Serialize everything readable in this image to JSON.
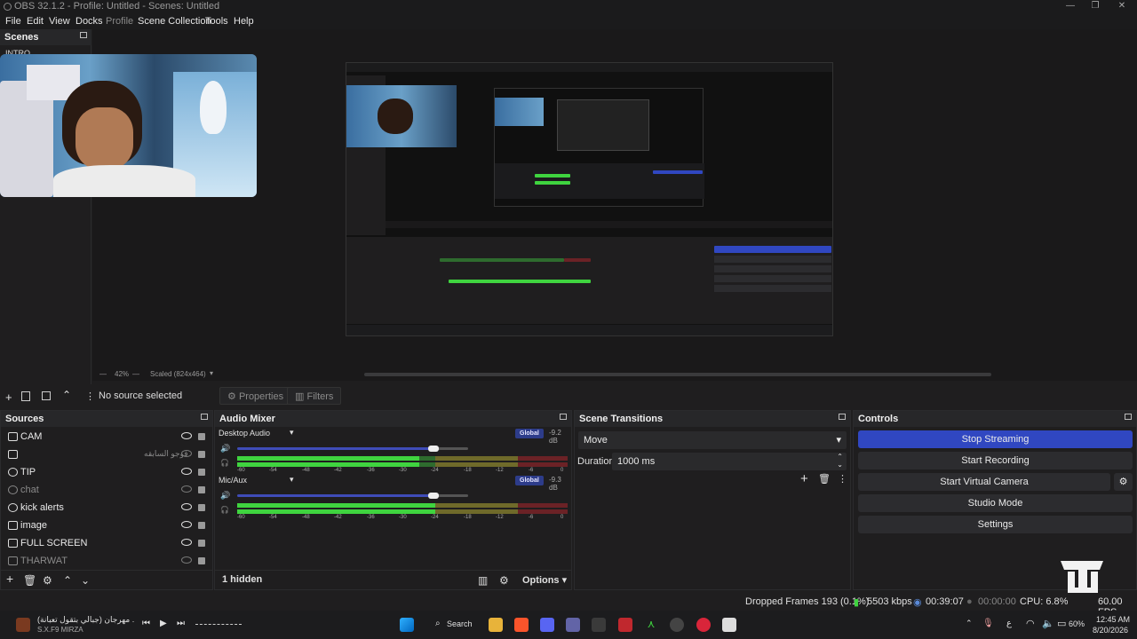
{
  "window": {
    "title": "OBS 32.1.2 - Profile: Untitled - Scenes: Untitled"
  },
  "menu": {
    "file": "File",
    "edit": "Edit",
    "view": "View",
    "docks": "Docks",
    "profile": "Profile",
    "scene_collection": "Scene Collection",
    "tools": "Tools",
    "help": "Help"
  },
  "scenes": {
    "title": "Scenes",
    "items": [
      "INTRO"
    ]
  },
  "preview": {
    "zoom": "42%",
    "scale": "Scaled (824x464)"
  },
  "context_bar": {
    "no_source": "No source selected",
    "properties": "Properties",
    "filters": "Filters"
  },
  "sources": {
    "title": "Sources",
    "items": [
      {
        "label": "CAM",
        "visible": true
      },
      {
        "label": "فوجو السابقه",
        "visible": false
      },
      {
        "label": "TIP",
        "visible": true
      },
      {
        "label": "chat",
        "visible": false
      },
      {
        "label": "kick alerts",
        "visible": true
      },
      {
        "label": "image",
        "visible": true
      },
      {
        "label": "FULL SCREEN",
        "visible": true
      },
      {
        "label": "THARWAT",
        "visible": false
      }
    ]
  },
  "mixer": {
    "title": "Audio Mixer",
    "channels": [
      {
        "name": "Desktop Audio",
        "badge": "Global",
        "db": "-9.2 dB",
        "volume": 0.85,
        "level": 0.55
      },
      {
        "name": "Mic/Aux",
        "badge": "Global",
        "db": "-9.3 dB",
        "volume": 0.85,
        "level": 0.6
      }
    ],
    "ticks": [
      "-60",
      "-54",
      "-48",
      "-42",
      "-36",
      "-30",
      "-24",
      "-18",
      "-12",
      "-6",
      "0"
    ],
    "hidden": "1 hidden",
    "options": "Options"
  },
  "transitions": {
    "title": "Scene Transitions",
    "type": "Move",
    "duration_label": "Duration",
    "duration": "1000 ms"
  },
  "controls": {
    "title": "Controls",
    "stop_streaming": "Stop Streaming",
    "start_recording": "Start Recording",
    "start_virtual_camera": "Start Virtual Camera",
    "studio_mode": "Studio Mode",
    "settings": "Settings"
  },
  "status": {
    "dropped_frames": "Dropped Frames 193 (0.1%)",
    "bitrate": "5503 kbps",
    "stream_time": "00:39:07",
    "rec_time": "00:00:00",
    "cpu": "CPU: 6.8%",
    "fps": "60.00 FPS"
  },
  "taskbar": {
    "media_title": "مهرجان (جبالي بتقول تعبانة) .",
    "media_artist": "S.X.F9 MIRZA",
    "search": "Search",
    "battery": "60%",
    "time": "12:45 AM",
    "date": "8/20/2026",
    "lang": "ع"
  },
  "colors": {
    "accent": "#3047c1",
    "panel_bg": "#1f1e1f",
    "meter_green": "#3fd43f",
    "meter_yellow": "#6f6a2a",
    "meter_red": "#6b2226"
  }
}
